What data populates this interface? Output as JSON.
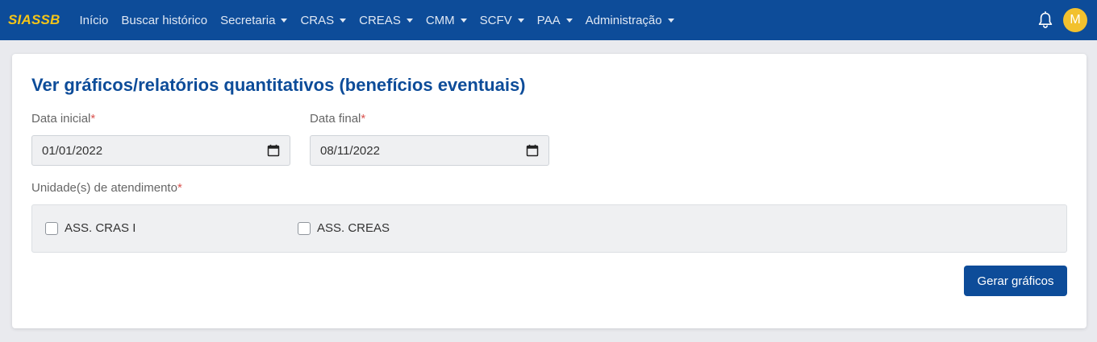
{
  "navbar": {
    "brand": "SIASSB",
    "items": [
      {
        "label": "Início",
        "dropdown": false
      },
      {
        "label": "Buscar histórico",
        "dropdown": false
      },
      {
        "label": "Secretaria",
        "dropdown": true
      },
      {
        "label": "CRAS",
        "dropdown": true
      },
      {
        "label": "CREAS",
        "dropdown": true
      },
      {
        "label": "CMM",
        "dropdown": true
      },
      {
        "label": "SCFV",
        "dropdown": true
      },
      {
        "label": "PAA",
        "dropdown": true
      },
      {
        "label": "Administração",
        "dropdown": true
      }
    ],
    "notification_icon": "bell-icon",
    "avatar_initial": "M"
  },
  "form": {
    "title": "Ver gráficos/relatórios quantitativos (benefícios eventuais)",
    "start_date": {
      "label": "Data inicial",
      "required_mark": "*",
      "value": "01/01/2022"
    },
    "end_date": {
      "label": "Data final",
      "required_mark": "*",
      "value": "08/11/2022"
    },
    "units": {
      "label": "Unidade(s) de atendimento",
      "required_mark": "*",
      "options": [
        {
          "label": "ASS. CRAS I",
          "checked": false
        },
        {
          "label": "ASS. CREAS",
          "checked": false
        }
      ]
    },
    "submit_label": "Gerar gráficos"
  },
  "colors": {
    "primary": "#0d4c99",
    "brand": "#f5c518",
    "avatar": "#f2c12e",
    "required": "#d9534f"
  }
}
